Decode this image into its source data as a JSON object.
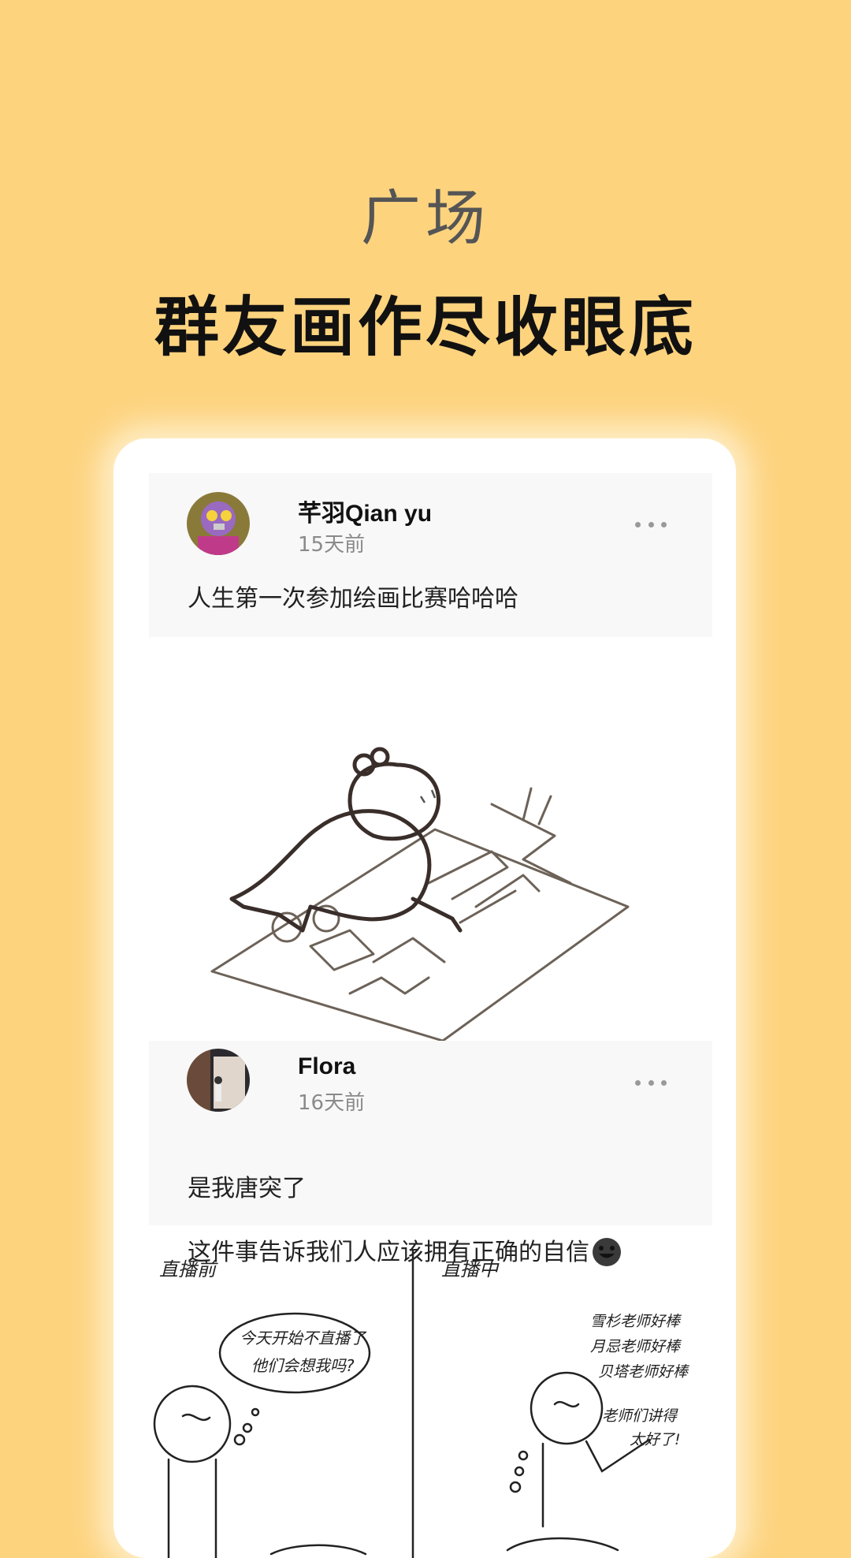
{
  "headline": {
    "title": "广场",
    "subtitle": "群友画作尽收眼底"
  },
  "posts": [
    {
      "username": "芊羽Qian yu",
      "time": "15天前",
      "text": "人生第一次参加绘画比赛哈哈哈",
      "more_icon": "more-dots-icon"
    },
    {
      "username": "Flora",
      "time": "16天前",
      "text": "是我唐突了\n这件事告诉我们人应该拥有正确的自信",
      "emoji": "dark-grinning-face-emoji",
      "more_icon": "more-dots-icon"
    }
  ],
  "comic": {
    "left_caption": "直播前",
    "right_caption": "直播中",
    "left_bubble_line1": "今天开始不直播了",
    "left_bubble_line2": "他们会想我吗?",
    "right_text_1": "雪杉老师好棒",
    "right_text_2": "月忌老师好棒",
    "right_text_3": "贝塔老师好棒",
    "right_text_4": "老师们讲得",
    "right_text_5": "太好了!"
  }
}
